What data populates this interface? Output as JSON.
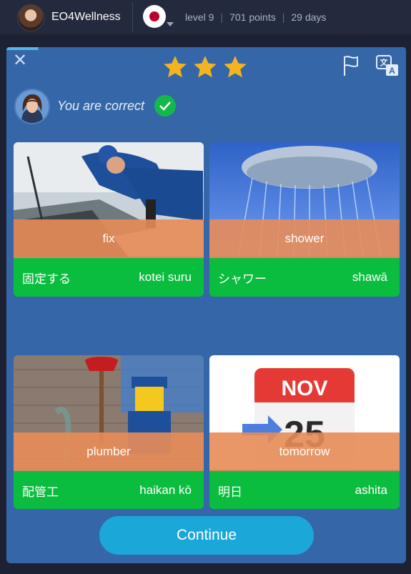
{
  "header": {
    "username": "EO4Wellness",
    "language_flag": "japan-flag-icon",
    "stats": [
      "level 9",
      "701 points",
      "29 days"
    ]
  },
  "exercise": {
    "stars_earned": 3,
    "stars_total": 3,
    "feedback": "You are correct",
    "cards": [
      {
        "english": "fix",
        "native": "固定する",
        "romaji": "kotei suru",
        "image": "mechanic-image"
      },
      {
        "english": "shower",
        "native": "シャワー",
        "romaji": "shawā",
        "image": "shower-image"
      },
      {
        "english": "plumber",
        "native": "配管工",
        "romaji": "haikan kō",
        "image": "plumber-image"
      },
      {
        "english": "tomorrow",
        "native": "明日",
        "romaji": "ashita",
        "image": "calendar-image",
        "calendar": {
          "month": "NOV",
          "day": "25"
        }
      }
    ],
    "continue_label": "Continue"
  },
  "colors": {
    "panel": "#3567a8",
    "card_footer": "#0bbd3f",
    "overlay": "#e88c58",
    "star": "#f4b321",
    "continue_button": "#1ba7d8"
  }
}
